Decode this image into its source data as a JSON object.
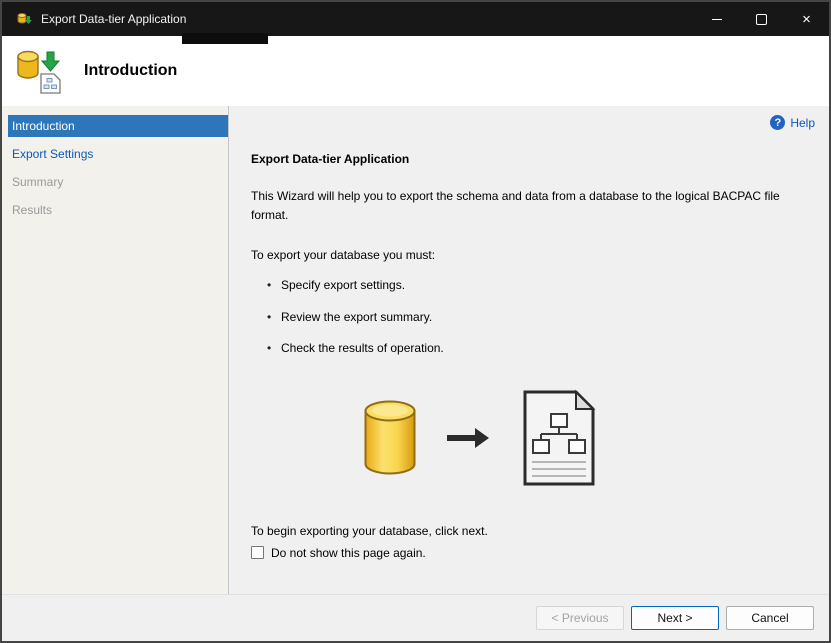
{
  "colors": {
    "titlebar_bg": "#171717",
    "accent_selected_blue": "#2e76ba",
    "link_blue": "#0a58b9",
    "content_bg": "#f0f0f0",
    "sidebar_bg": "#f2f1ec",
    "next_button_border": "#0067c0",
    "cylinder_yellow": "#f2c73a",
    "arrow_green": "#27a348"
  },
  "window": {
    "title": "Export Data-tier Application",
    "controls": {
      "close_glyph": "×"
    }
  },
  "header": {
    "title": "Introduction"
  },
  "sidebar": {
    "items": [
      {
        "label": "Introduction",
        "state": "active"
      },
      {
        "label": "Export Settings",
        "state": "link"
      },
      {
        "label": "Summary",
        "state": "disabled"
      },
      {
        "label": "Results",
        "state": "disabled"
      }
    ]
  },
  "help": {
    "label": "Help",
    "glyph": "?"
  },
  "content": {
    "heading": "Export Data-tier Application",
    "intro": "This Wizard will help you to export the schema and data from a database to the logical BACPAC file format.",
    "must_label": "To export your database you must:",
    "bullets": [
      "Specify export settings.",
      "Review the export summary.",
      "Check the results of operation."
    ],
    "graphic": {
      "left_icon": "database-cylinder-icon",
      "middle_icon": "right-arrow-icon",
      "right_icon": "bacpac-file-icon"
    },
    "begin_text": "To begin exporting your database, click next.",
    "checkbox_label": "Do not show this page again.",
    "checkbox_checked": false
  },
  "footer": {
    "previous_label": "< Previous",
    "next_label": "Next >",
    "cancel_label": "Cancel"
  }
}
